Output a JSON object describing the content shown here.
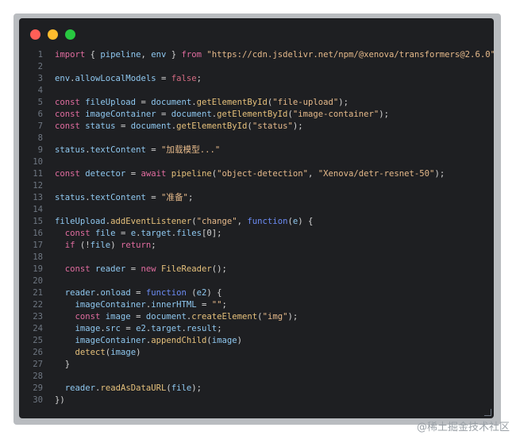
{
  "window": {
    "traffic_lights": {
      "close": "#ff5f57",
      "minimize": "#febc2e",
      "zoom": "#28c840"
    }
  },
  "code": {
    "lines": [
      {
        "n": "1",
        "parts": [
          [
            "kw",
            "import"
          ],
          [
            "plain",
            " { "
          ],
          [
            "prop",
            "pipeline"
          ],
          [
            "plain",
            ", "
          ],
          [
            "prop",
            "env"
          ],
          [
            "plain",
            " } "
          ],
          [
            "kw",
            "from"
          ],
          [
            "plain",
            " "
          ],
          [
            "str",
            "\"https://cdn.jsdelivr.net/npm/@xenova/transformers@2.6.0\""
          ],
          [
            "plain",
            ";"
          ]
        ]
      },
      {
        "n": "2",
        "parts": []
      },
      {
        "n": "3",
        "parts": [
          [
            "prop",
            "env"
          ],
          [
            "plain",
            "."
          ],
          [
            "prop",
            "allowLocalModels"
          ],
          [
            "plain",
            " = "
          ],
          [
            "bool",
            "false"
          ],
          [
            "plain",
            ";"
          ]
        ]
      },
      {
        "n": "4",
        "parts": []
      },
      {
        "n": "5",
        "parts": [
          [
            "kw",
            "const"
          ],
          [
            "plain",
            " "
          ],
          [
            "prop",
            "fileUpload"
          ],
          [
            "plain",
            " = "
          ],
          [
            "prop",
            "document"
          ],
          [
            "plain",
            "."
          ],
          [
            "fn",
            "getElementById"
          ],
          [
            "plain",
            "("
          ],
          [
            "str",
            "\"file-upload\""
          ],
          [
            "plain",
            ");"
          ]
        ]
      },
      {
        "n": "6",
        "parts": [
          [
            "kw",
            "const"
          ],
          [
            "plain",
            " "
          ],
          [
            "prop",
            "imageContainer"
          ],
          [
            "plain",
            " = "
          ],
          [
            "prop",
            "document"
          ],
          [
            "plain",
            "."
          ],
          [
            "fn",
            "getElementById"
          ],
          [
            "plain",
            "("
          ],
          [
            "str",
            "\"image-container\""
          ],
          [
            "plain",
            ");"
          ]
        ]
      },
      {
        "n": "7",
        "parts": [
          [
            "kw",
            "const"
          ],
          [
            "plain",
            " "
          ],
          [
            "prop",
            "status"
          ],
          [
            "plain",
            " = "
          ],
          [
            "prop",
            "document"
          ],
          [
            "plain",
            "."
          ],
          [
            "fn",
            "getElementById"
          ],
          [
            "plain",
            "("
          ],
          [
            "str",
            "\"status\""
          ],
          [
            "plain",
            ");"
          ]
        ]
      },
      {
        "n": "8",
        "parts": []
      },
      {
        "n": "9",
        "parts": [
          [
            "prop",
            "status"
          ],
          [
            "plain",
            "."
          ],
          [
            "prop",
            "textContent"
          ],
          [
            "plain",
            " = "
          ],
          [
            "str",
            "\"加载模型...\""
          ]
        ]
      },
      {
        "n": "10",
        "parts": []
      },
      {
        "n": "11",
        "parts": [
          [
            "kw",
            "const"
          ],
          [
            "plain",
            " "
          ],
          [
            "prop",
            "detector"
          ],
          [
            "plain",
            " = "
          ],
          [
            "kw",
            "await"
          ],
          [
            "plain",
            " "
          ],
          [
            "fn",
            "pipeline"
          ],
          [
            "plain",
            "("
          ],
          [
            "str",
            "\"object-detection\""
          ],
          [
            "plain",
            ", "
          ],
          [
            "str",
            "\"Xenova/detr-resnet-50\""
          ],
          [
            "plain",
            ");"
          ]
        ]
      },
      {
        "n": "12",
        "parts": []
      },
      {
        "n": "13",
        "parts": [
          [
            "prop",
            "status"
          ],
          [
            "plain",
            "."
          ],
          [
            "prop",
            "textContent"
          ],
          [
            "plain",
            " = "
          ],
          [
            "str",
            "\"准备\""
          ],
          [
            "plain",
            ";"
          ]
        ]
      },
      {
        "n": "14",
        "parts": []
      },
      {
        "n": "15",
        "parts": [
          [
            "prop",
            "fileUpload"
          ],
          [
            "plain",
            "."
          ],
          [
            "fn",
            "addEventListener"
          ],
          [
            "plain",
            "("
          ],
          [
            "str",
            "\"change\""
          ],
          [
            "plain",
            ", "
          ],
          [
            "kw2",
            "function"
          ],
          [
            "plain",
            "("
          ],
          [
            "prop",
            "e"
          ],
          [
            "plain",
            ") {"
          ]
        ]
      },
      {
        "n": "16",
        "parts": [
          [
            "plain",
            "  "
          ],
          [
            "kw",
            "const"
          ],
          [
            "plain",
            " "
          ],
          [
            "prop",
            "file"
          ],
          [
            "plain",
            " = "
          ],
          [
            "prop",
            "e"
          ],
          [
            "plain",
            "."
          ],
          [
            "prop",
            "target"
          ],
          [
            "plain",
            "."
          ],
          [
            "prop",
            "files"
          ],
          [
            "plain",
            "[0];"
          ]
        ]
      },
      {
        "n": "17",
        "parts": [
          [
            "plain",
            "  "
          ],
          [
            "kw",
            "if"
          ],
          [
            "plain",
            " (!"
          ],
          [
            "prop",
            "file"
          ],
          [
            "plain",
            ") "
          ],
          [
            "kw",
            "return"
          ],
          [
            "plain",
            ";"
          ]
        ]
      },
      {
        "n": "18",
        "parts": []
      },
      {
        "n": "19",
        "parts": [
          [
            "plain",
            "  "
          ],
          [
            "kw",
            "const"
          ],
          [
            "plain",
            " "
          ],
          [
            "prop",
            "reader"
          ],
          [
            "plain",
            " = "
          ],
          [
            "kw",
            "new"
          ],
          [
            "plain",
            " "
          ],
          [
            "fn",
            "FileReader"
          ],
          [
            "plain",
            "();"
          ]
        ]
      },
      {
        "n": "20",
        "parts": []
      },
      {
        "n": "21",
        "parts": [
          [
            "plain",
            "  "
          ],
          [
            "prop",
            "reader"
          ],
          [
            "plain",
            "."
          ],
          [
            "prop",
            "onload"
          ],
          [
            "plain",
            " = "
          ],
          [
            "kw2",
            "function"
          ],
          [
            "plain",
            " ("
          ],
          [
            "prop",
            "e2"
          ],
          [
            "plain",
            ") {"
          ]
        ]
      },
      {
        "n": "22",
        "parts": [
          [
            "plain",
            "    "
          ],
          [
            "prop",
            "imageContainer"
          ],
          [
            "plain",
            "."
          ],
          [
            "prop",
            "innerHTML"
          ],
          [
            "plain",
            " = "
          ],
          [
            "str",
            "\"\""
          ],
          [
            "plain",
            ";"
          ]
        ]
      },
      {
        "n": "23",
        "parts": [
          [
            "plain",
            "    "
          ],
          [
            "kw",
            "const"
          ],
          [
            "plain",
            " "
          ],
          [
            "prop",
            "image"
          ],
          [
            "plain",
            " = "
          ],
          [
            "prop",
            "document"
          ],
          [
            "plain",
            "."
          ],
          [
            "fn",
            "createElement"
          ],
          [
            "plain",
            "("
          ],
          [
            "str",
            "\"img\""
          ],
          [
            "plain",
            ");"
          ]
        ]
      },
      {
        "n": "24",
        "parts": [
          [
            "plain",
            "    "
          ],
          [
            "prop",
            "image"
          ],
          [
            "plain",
            "."
          ],
          [
            "prop",
            "src"
          ],
          [
            "plain",
            " = "
          ],
          [
            "prop",
            "e2"
          ],
          [
            "plain",
            "."
          ],
          [
            "prop",
            "target"
          ],
          [
            "plain",
            "."
          ],
          [
            "prop",
            "result"
          ],
          [
            "plain",
            ";"
          ]
        ]
      },
      {
        "n": "25",
        "parts": [
          [
            "plain",
            "    "
          ],
          [
            "prop",
            "imageContainer"
          ],
          [
            "plain",
            "."
          ],
          [
            "fn",
            "appendChild"
          ],
          [
            "plain",
            "("
          ],
          [
            "prop",
            "image"
          ],
          [
            "plain",
            ")"
          ]
        ]
      },
      {
        "n": "26",
        "parts": [
          [
            "plain",
            "    "
          ],
          [
            "fn",
            "detect"
          ],
          [
            "plain",
            "("
          ],
          [
            "prop",
            "image"
          ],
          [
            "plain",
            ")"
          ]
        ]
      },
      {
        "n": "27",
        "parts": [
          [
            "plain",
            "  }"
          ]
        ]
      },
      {
        "n": "28",
        "parts": []
      },
      {
        "n": "29",
        "parts": [
          [
            "plain",
            "  "
          ],
          [
            "prop",
            "reader"
          ],
          [
            "plain",
            "."
          ],
          [
            "fn",
            "readAsDataURL"
          ],
          [
            "plain",
            "("
          ],
          [
            "prop",
            "file"
          ],
          [
            "plain",
            ");"
          ]
        ]
      },
      {
        "n": "30",
        "parts": [
          [
            "plain",
            "})"
          ]
        ]
      }
    ]
  },
  "watermark": "@稀土掘金技术社区"
}
